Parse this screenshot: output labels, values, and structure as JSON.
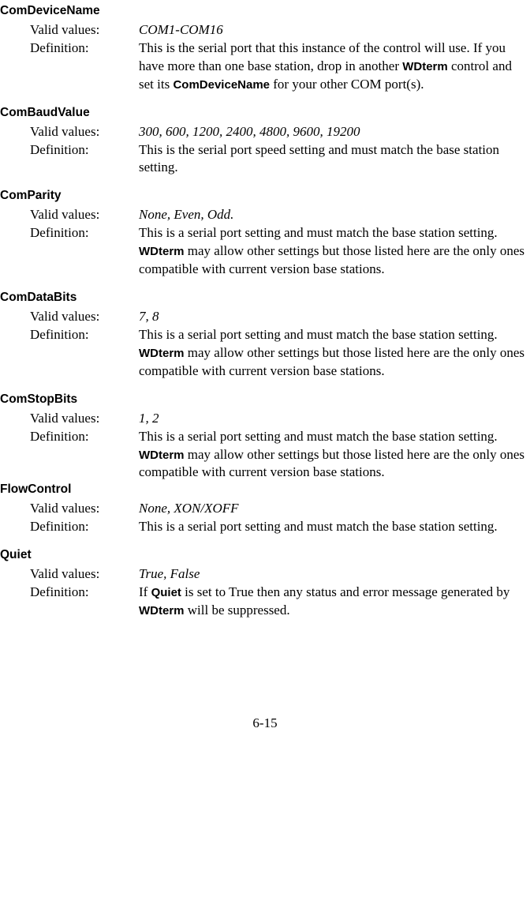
{
  "props": {
    "com_device_name": {
      "name": "ComDeviceName",
      "valid": "COM1-COM16",
      "def_a": "This is the serial port that this instance of the control will use. If you have more than one base station, drop in another ",
      "def_b": "WDterm",
      "def_c": " control and set its ",
      "def_d": "ComDeviceName",
      "def_e": " for your other COM port(s)."
    },
    "com_baud_value": {
      "name": "ComBaudValue",
      "valid": "300, 600, 1200, 2400, 4800, 9600, 19200",
      "def": "This is the serial port speed setting and must match the base station setting."
    },
    "com_parity": {
      "name": "ComParity",
      "valid": "None, Even, Odd.",
      "def_a": "This is a serial port setting and must match the base station setting. ",
      "def_b": "WDterm",
      "def_c": " may allow other settings but those listed here are the only ones compatible with current version base stations."
    },
    "com_data_bits": {
      "name": "ComDataBits",
      "valid": "7, 8",
      "def_a": "This is a serial port setting and must match the base station setting. ",
      "def_b": "WDterm",
      "def_c": " may allow other settings but those listed here are the only ones compatible with current version base stations."
    },
    "com_stop_bits": {
      "name": "ComStopBits",
      "valid": "1, 2",
      "def_a": "This is a serial port setting and must match the base station setting. ",
      "def_b": "WDterm",
      "def_c": " may allow other settings but those listed here are the only ones compatible with current version base stations."
    },
    "flow_control": {
      "name": "FlowControl",
      "valid": "None, XON/XOFF",
      "def": "This is a serial port setting and must match the base station setting."
    },
    "quiet": {
      "name": "Quiet",
      "valid": "True, False",
      "def_a": "If ",
      "def_b": "Quiet",
      "def_c": " is set to True then any status and error message generated by ",
      "def_d": "WDterm",
      "def_e": " will be suppressed."
    }
  },
  "labels": {
    "valid": "Valid values:",
    "def": "Definition:"
  },
  "page_number": "6-15"
}
